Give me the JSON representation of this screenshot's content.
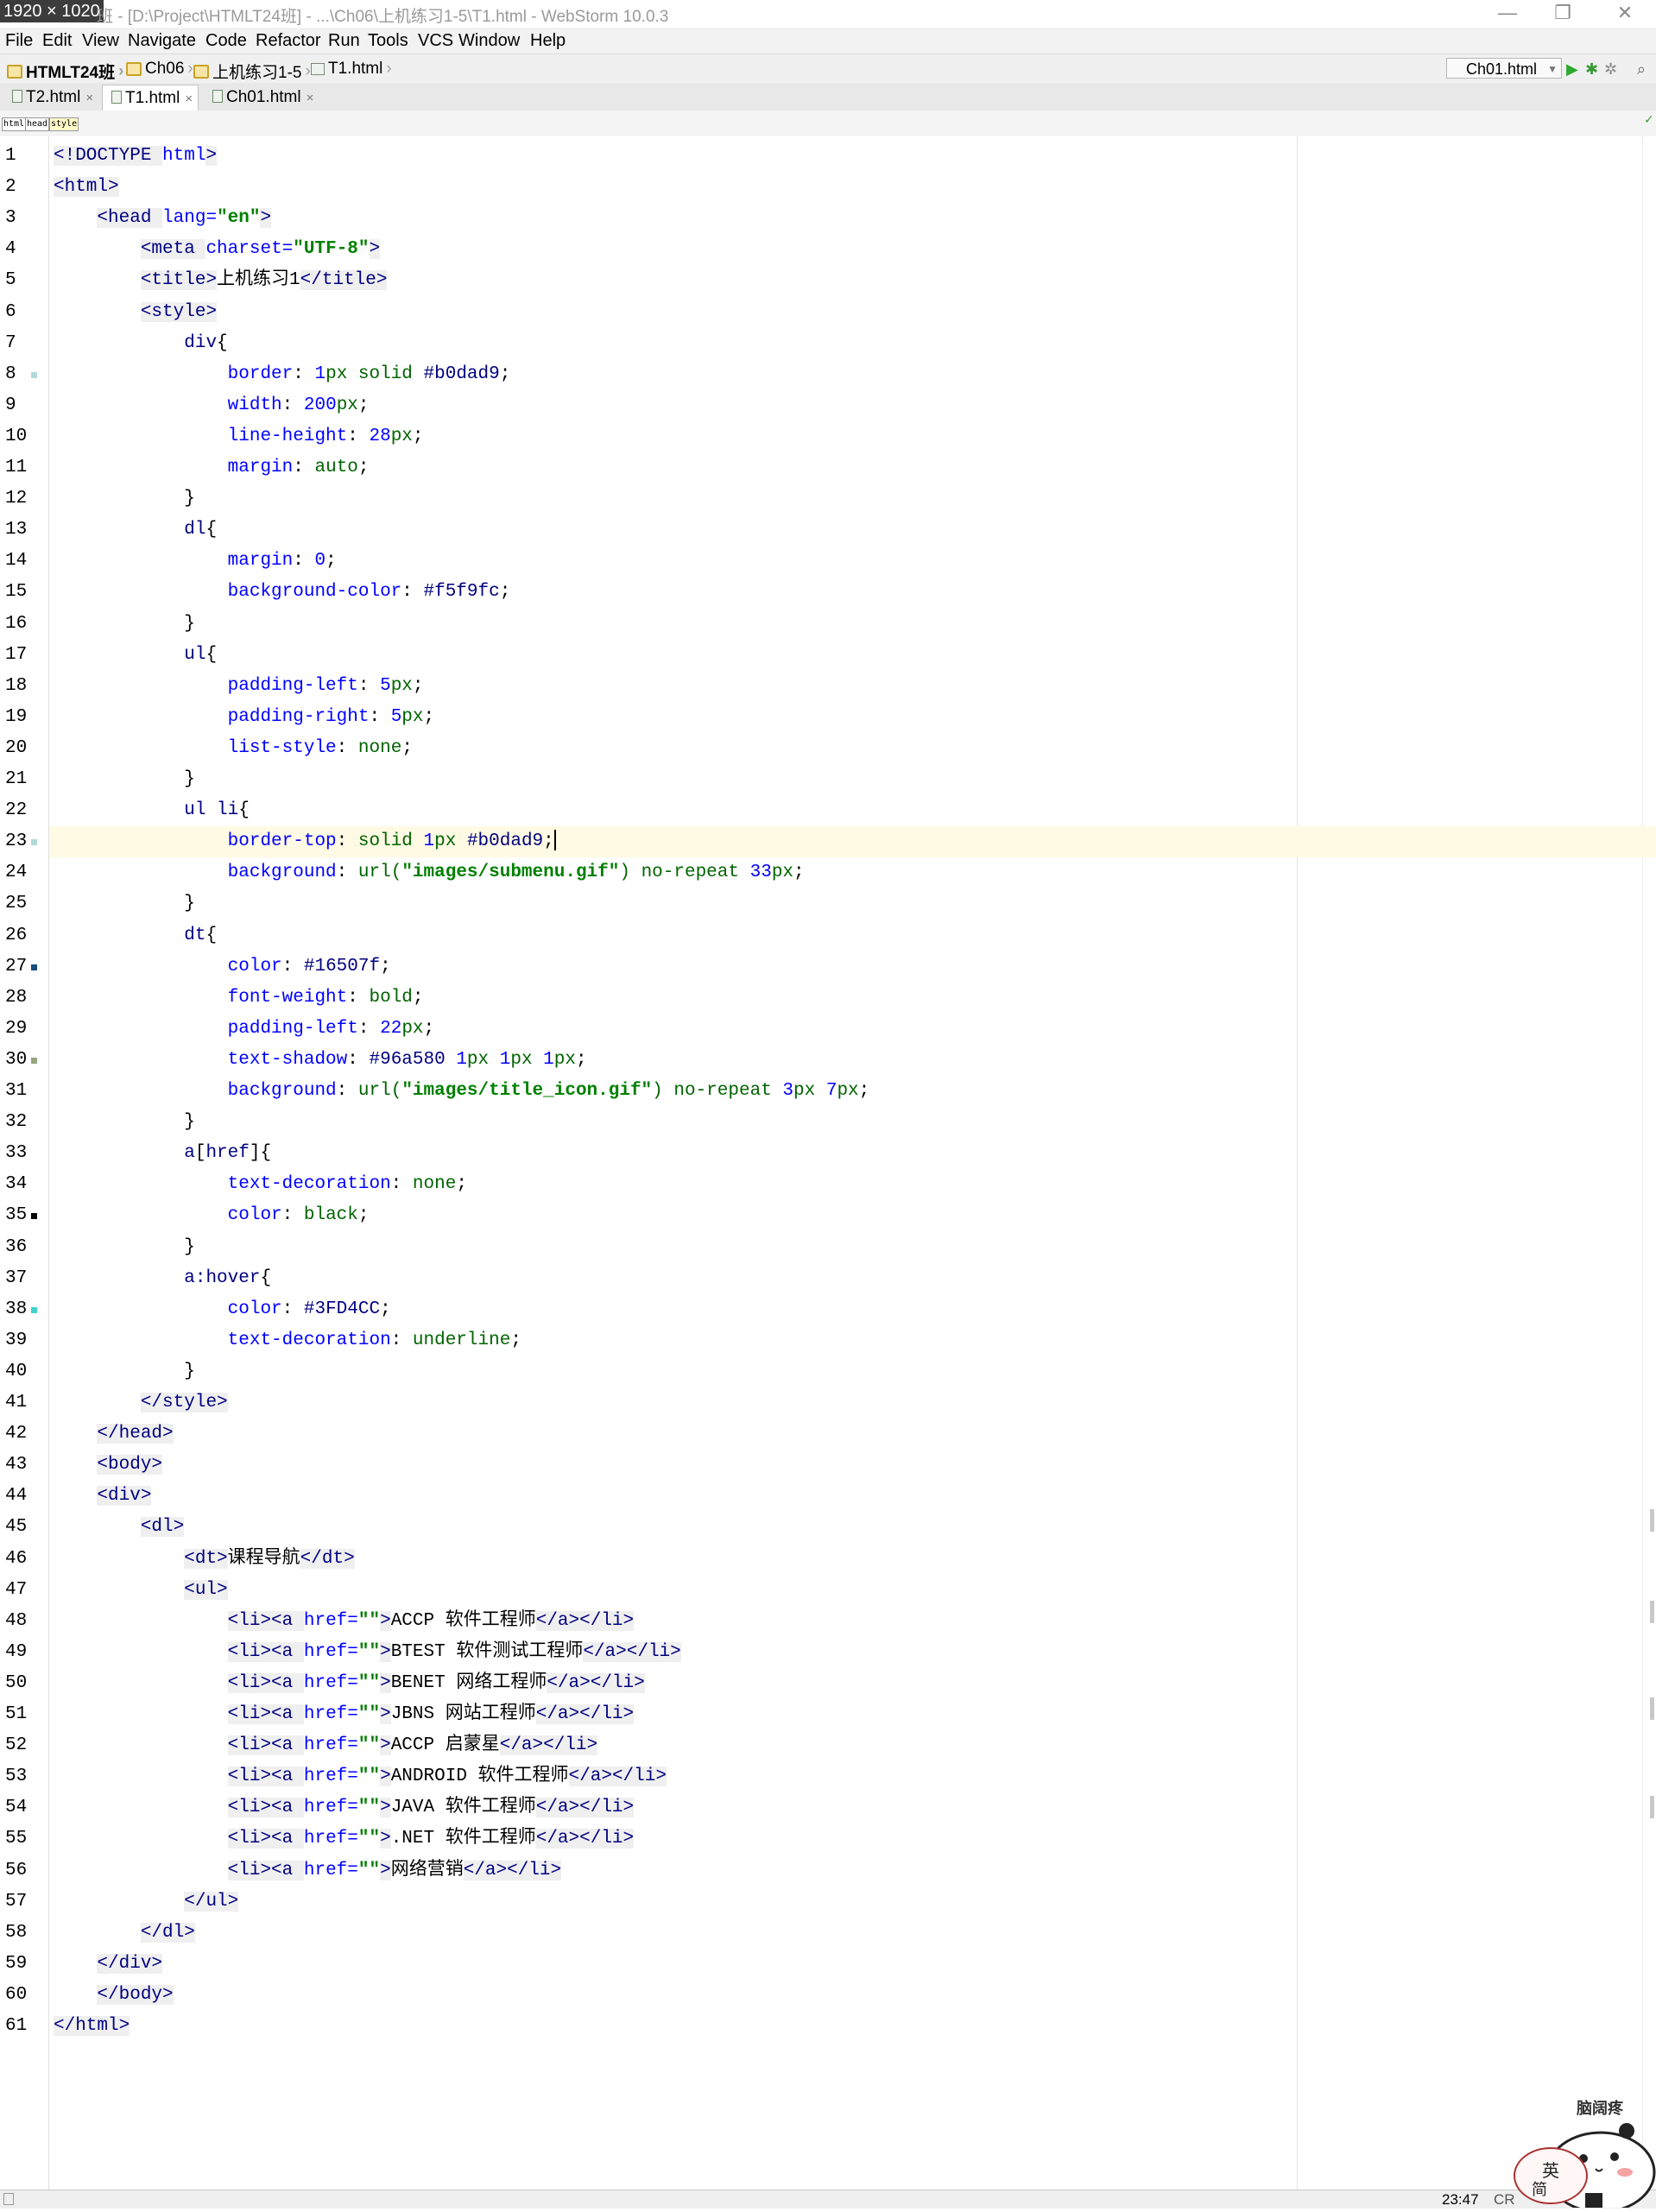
{
  "window": {
    "dim_badge": "1920 × 1020",
    "title": "班 - [D:\\Project\\HTMLT24班] - ...\\Ch06\\上机练习1-5\\T1.html - WebStorm 10.0.3",
    "minimize": "—",
    "restore": "❐",
    "close": "✕"
  },
  "menu": {
    "items": [
      {
        "label": "File"
      },
      {
        "label": "Edit"
      },
      {
        "label": "View"
      },
      {
        "label": "Navigate"
      },
      {
        "label": "Code"
      },
      {
        "label": "Refactor"
      },
      {
        "label": "Run"
      },
      {
        "label": "Tools"
      },
      {
        "label": "VCS"
      },
      {
        "label": "Window"
      },
      {
        "label": "Help"
      }
    ]
  },
  "breadcrumb": {
    "items": [
      {
        "label": "HTMLT24班",
        "icon": "folder-icon"
      },
      {
        "label": "Ch06",
        "icon": "folder-icon"
      },
      {
        "label": "上机练习1-5",
        "icon": "folder-icon"
      },
      {
        "label": "T1.html",
        "icon": "html-file-icon"
      }
    ],
    "run_config": "Ch01.html"
  },
  "tabs": [
    {
      "label": "T2.html",
      "active": false
    },
    {
      "label": "T1.html",
      "active": true
    },
    {
      "label": "Ch01.html",
      "active": false
    }
  ],
  "tag_path": [
    "html",
    "head",
    "style"
  ],
  "status": {
    "position": "23:47",
    "encoding": "CR"
  },
  "mascot": {
    "caption": "脑阔疼",
    "lang1": "英",
    "lang2": "简"
  },
  "editor": {
    "caret_line": 23,
    "colors": {
      "tag": "#000080",
      "attr": "#0000ff",
      "string": "#008000",
      "caret_row_bg": "#fffae3"
    },
    "lines": [
      [
        [
          "tg",
          "<!DOCTYPE "
        ],
        [
          "at",
          "html"
        ],
        [
          "tg",
          ">"
        ]
      ],
      [
        [
          "tg",
          "<html>"
        ]
      ],
      [
        [
          "i",
          "    "
        ],
        [
          "tg",
          "<head "
        ],
        [
          "at",
          "lang="
        ],
        [
          "sv",
          "\"en\""
        ],
        [
          "tg",
          ">"
        ]
      ],
      [
        [
          "i",
          "        "
        ],
        [
          "tg",
          "<meta "
        ],
        [
          "at",
          "charset="
        ],
        [
          "sv",
          "\"UTF-8\""
        ],
        [
          "tg",
          ">"
        ]
      ],
      [
        [
          "i",
          "        "
        ],
        [
          "tg",
          "<title>"
        ],
        [
          "pu",
          "上机练习1"
        ],
        [
          "tg",
          "</title>"
        ]
      ],
      [
        [
          "i",
          "        "
        ],
        [
          "tg",
          "<style>"
        ]
      ],
      [
        [
          "i",
          "            "
        ],
        [
          "sl",
          "div"
        ],
        [
          "pu",
          "{"
        ]
      ],
      [
        [
          "i",
          "                "
        ],
        [
          "pr",
          "border"
        ],
        [
          "pu",
          ": "
        ],
        [
          "nm",
          "1"
        ],
        [
          "vl",
          "px solid "
        ],
        [
          "sl",
          "#b0dad9"
        ],
        [
          "pu",
          ";"
        ]
      ],
      [
        [
          "i",
          "                "
        ],
        [
          "pr",
          "width"
        ],
        [
          "pu",
          ": "
        ],
        [
          "nm",
          "200"
        ],
        [
          "vl",
          "px"
        ],
        [
          "pu",
          ";"
        ]
      ],
      [
        [
          "i",
          "                "
        ],
        [
          "pr",
          "line-height"
        ],
        [
          "pu",
          ": "
        ],
        [
          "nm",
          "28"
        ],
        [
          "vl",
          "px"
        ],
        [
          "pu",
          ";"
        ]
      ],
      [
        [
          "i",
          "                "
        ],
        [
          "pr",
          "margin"
        ],
        [
          "pu",
          ": "
        ],
        [
          "vl",
          "auto"
        ],
        [
          "pu",
          ";"
        ]
      ],
      [
        [
          "i",
          "            "
        ],
        [
          "pu",
          "}"
        ]
      ],
      [
        [
          "i",
          "            "
        ],
        [
          "sl",
          "dl"
        ],
        [
          "pu",
          "{"
        ]
      ],
      [
        [
          "i",
          "                "
        ],
        [
          "pr",
          "margin"
        ],
        [
          "pu",
          ": "
        ],
        [
          "nm",
          "0"
        ],
        [
          "pu",
          ";"
        ]
      ],
      [
        [
          "i",
          "                "
        ],
        [
          "pr",
          "background-color"
        ],
        [
          "pu",
          ": "
        ],
        [
          "sl",
          "#f5f9fc"
        ],
        [
          "pu",
          ";"
        ]
      ],
      [
        [
          "i",
          "            "
        ],
        [
          "pu",
          "}"
        ]
      ],
      [
        [
          "i",
          "            "
        ],
        [
          "sl",
          "ul"
        ],
        [
          "pu",
          "{"
        ]
      ],
      [
        [
          "i",
          "                "
        ],
        [
          "pr",
          "padding-left"
        ],
        [
          "pu",
          ": "
        ],
        [
          "nm",
          "5"
        ],
        [
          "vl",
          "px"
        ],
        [
          "pu",
          ";"
        ]
      ],
      [
        [
          "i",
          "                "
        ],
        [
          "pr",
          "padding-right"
        ],
        [
          "pu",
          ": "
        ],
        [
          "nm",
          "5"
        ],
        [
          "vl",
          "px"
        ],
        [
          "pu",
          ";"
        ]
      ],
      [
        [
          "i",
          "                "
        ],
        [
          "pr",
          "list-style"
        ],
        [
          "pu",
          ": "
        ],
        [
          "vl",
          "none"
        ],
        [
          "pu",
          ";"
        ]
      ],
      [
        [
          "i",
          "            "
        ],
        [
          "pu",
          "}"
        ]
      ],
      [
        [
          "i",
          "            "
        ],
        [
          "sl",
          "ul li"
        ],
        [
          "pu",
          "{"
        ]
      ],
      [
        [
          "i",
          "                "
        ],
        [
          "pr",
          "border-top"
        ],
        [
          "pu",
          ": "
        ],
        [
          "vl",
          "solid "
        ],
        [
          "nm",
          "1"
        ],
        [
          "vl",
          "px "
        ],
        [
          "sl",
          "#b0dad9"
        ],
        [
          "pu",
          ";"
        ]
      ],
      [
        [
          "i",
          "                "
        ],
        [
          "pr",
          "background"
        ],
        [
          "pu",
          ": "
        ],
        [
          "vl",
          "url("
        ],
        [
          "sv",
          "\"images/submenu.gif\""
        ],
        [
          "vl",
          ") no-repeat "
        ],
        [
          "nm",
          "33"
        ],
        [
          "vl",
          "px"
        ],
        [
          "pu",
          ";"
        ]
      ],
      [
        [
          "i",
          "            "
        ],
        [
          "pu",
          "}"
        ]
      ],
      [
        [
          "i",
          "            "
        ],
        [
          "sl",
          "dt"
        ],
        [
          "pu",
          "{"
        ]
      ],
      [
        [
          "i",
          "                "
        ],
        [
          "pr",
          "color"
        ],
        [
          "pu",
          ": "
        ],
        [
          "sl",
          "#16507f"
        ],
        [
          "pu",
          ";"
        ]
      ],
      [
        [
          "i",
          "                "
        ],
        [
          "pr",
          "font-weight"
        ],
        [
          "pu",
          ": "
        ],
        [
          "vl",
          "bold"
        ],
        [
          "pu",
          ";"
        ]
      ],
      [
        [
          "i",
          "                "
        ],
        [
          "pr",
          "padding-left"
        ],
        [
          "pu",
          ": "
        ],
        [
          "nm",
          "22"
        ],
        [
          "vl",
          "px"
        ],
        [
          "pu",
          ";"
        ]
      ],
      [
        [
          "i",
          "                "
        ],
        [
          "pr",
          "text-shadow"
        ],
        [
          "pu",
          ": "
        ],
        [
          "sl",
          "#96a580 "
        ],
        [
          "nm",
          "1"
        ],
        [
          "vl",
          "px "
        ],
        [
          "nm",
          "1"
        ],
        [
          "vl",
          "px "
        ],
        [
          "nm",
          "1"
        ],
        [
          "vl",
          "px"
        ],
        [
          "pu",
          ";"
        ]
      ],
      [
        [
          "i",
          "                "
        ],
        [
          "pr",
          "background"
        ],
        [
          "pu",
          ": "
        ],
        [
          "vl",
          "url("
        ],
        [
          "sv",
          "\"images/title_icon.gif\""
        ],
        [
          "vl",
          ") no-repeat "
        ],
        [
          "nm",
          "3"
        ],
        [
          "vl",
          "px "
        ],
        [
          "nm",
          "7"
        ],
        [
          "vl",
          "px"
        ],
        [
          "pu",
          ";"
        ]
      ],
      [
        [
          "i",
          "            "
        ],
        [
          "pu",
          "}"
        ]
      ],
      [
        [
          "i",
          "            "
        ],
        [
          "sl",
          "a"
        ],
        [
          "pu",
          "["
        ],
        [
          "sl",
          "href"
        ],
        [
          "pu",
          "]{"
        ]
      ],
      [
        [
          "i",
          "                "
        ],
        [
          "pr",
          "text-decoration"
        ],
        [
          "pu",
          ": "
        ],
        [
          "vl",
          "none"
        ],
        [
          "pu",
          ";"
        ]
      ],
      [
        [
          "i",
          "                "
        ],
        [
          "pr",
          "color"
        ],
        [
          "pu",
          ": "
        ],
        [
          "vl",
          "black"
        ],
        [
          "pu",
          ";"
        ]
      ],
      [
        [
          "i",
          "            "
        ],
        [
          "pu",
          "}"
        ]
      ],
      [
        [
          "i",
          "            "
        ],
        [
          "sl",
          "a:hover"
        ],
        [
          "pu",
          "{"
        ]
      ],
      [
        [
          "i",
          "                "
        ],
        [
          "pr",
          "color"
        ],
        [
          "pu",
          ": "
        ],
        [
          "sl",
          "#3FD4CC"
        ],
        [
          "pu",
          ";"
        ]
      ],
      [
        [
          "i",
          "                "
        ],
        [
          "pr",
          "text-decoration"
        ],
        [
          "pu",
          ": "
        ],
        [
          "vl",
          "underline"
        ],
        [
          "pu",
          ";"
        ]
      ],
      [
        [
          "i",
          "            "
        ],
        [
          "pu",
          "}"
        ]
      ],
      [
        [
          "i",
          "        "
        ],
        [
          "tg",
          "</style>"
        ]
      ],
      [
        [
          "i",
          "    "
        ],
        [
          "tg",
          "</head>"
        ]
      ],
      [
        [
          "i",
          "    "
        ],
        [
          "tg",
          "<body>"
        ]
      ],
      [
        [
          "i",
          "    "
        ],
        [
          "tg",
          "<div>"
        ]
      ],
      [
        [
          "i",
          "        "
        ],
        [
          "tg",
          "<dl>"
        ]
      ],
      [
        [
          "i",
          "            "
        ],
        [
          "tg",
          "<dt>"
        ],
        [
          "pu",
          "课程导航"
        ],
        [
          "tg",
          "</dt>"
        ]
      ],
      [
        [
          "i",
          "            "
        ],
        [
          "tg",
          "<ul>"
        ]
      ],
      [
        [
          "i",
          "                "
        ],
        [
          "tg",
          "<li><a "
        ],
        [
          "at",
          "href="
        ],
        [
          "sv",
          "\"\""
        ],
        [
          "tg",
          ">"
        ],
        [
          "pu",
          "ACCP 软件工程师"
        ],
        [
          "tg",
          "</a></li>"
        ]
      ],
      [
        [
          "i",
          "                "
        ],
        [
          "tg",
          "<li><a "
        ],
        [
          "at",
          "href="
        ],
        [
          "sv",
          "\"\""
        ],
        [
          "tg",
          ">"
        ],
        [
          "pu",
          "BTEST 软件测试工程师"
        ],
        [
          "tg",
          "</a></li>"
        ]
      ],
      [
        [
          "i",
          "                "
        ],
        [
          "tg",
          "<li><a "
        ],
        [
          "at",
          "href="
        ],
        [
          "sv",
          "\"\""
        ],
        [
          "tg",
          ">"
        ],
        [
          "pu",
          "BENET 网络工程师"
        ],
        [
          "tg",
          "</a></li>"
        ]
      ],
      [
        [
          "i",
          "                "
        ],
        [
          "tg",
          "<li><a "
        ],
        [
          "at",
          "href="
        ],
        [
          "sv",
          "\"\""
        ],
        [
          "tg",
          ">"
        ],
        [
          "pu",
          "JBNS 网站工程师"
        ],
        [
          "tg",
          "</a></li>"
        ]
      ],
      [
        [
          "i",
          "                "
        ],
        [
          "tg",
          "<li><a "
        ],
        [
          "at",
          "href="
        ],
        [
          "sv",
          "\"\""
        ],
        [
          "tg",
          ">"
        ],
        [
          "pu",
          "ACCP 启蒙星"
        ],
        [
          "tg",
          "</a></li>"
        ]
      ],
      [
        [
          "i",
          "                "
        ],
        [
          "tg",
          "<li><a "
        ],
        [
          "at",
          "href="
        ],
        [
          "sv",
          "\"\""
        ],
        [
          "tg",
          ">"
        ],
        [
          "pu",
          "ANDROID 软件工程师"
        ],
        [
          "tg",
          "</a></li>"
        ]
      ],
      [
        [
          "i",
          "                "
        ],
        [
          "tg",
          "<li><a "
        ],
        [
          "at",
          "href="
        ],
        [
          "sv",
          "\"\""
        ],
        [
          "tg",
          ">"
        ],
        [
          "pu",
          "JAVA 软件工程师"
        ],
        [
          "tg",
          "</a></li>"
        ]
      ],
      [
        [
          "i",
          "                "
        ],
        [
          "tg",
          "<li><a "
        ],
        [
          "at",
          "href="
        ],
        [
          "sv",
          "\"\""
        ],
        [
          "tg",
          ">"
        ],
        [
          "pu",
          ".NET 软件工程师"
        ],
        [
          "tg",
          "</a></li>"
        ]
      ],
      [
        [
          "i",
          "                "
        ],
        [
          "tg",
          "<li><a "
        ],
        [
          "at",
          "href="
        ],
        [
          "sv",
          "\"\""
        ],
        [
          "tg",
          ">"
        ],
        [
          "pu",
          "网络营销"
        ],
        [
          "tg",
          "</a></li>"
        ]
      ],
      [
        [
          "i",
          "            "
        ],
        [
          "tg",
          "</ul>"
        ]
      ],
      [
        [
          "i",
          "        "
        ],
        [
          "tg",
          "</dl>"
        ]
      ],
      [
        [
          "i",
          "    "
        ],
        [
          "tg",
          "</div>"
        ]
      ],
      [
        [
          "i",
          "    "
        ],
        [
          "tg",
          "</body>"
        ]
      ],
      [
        [
          "tg",
          "</html>"
        ]
      ]
    ],
    "markers": [
      {
        "line": 8,
        "color": "#b0dad9"
      },
      {
        "line": 23,
        "color": "#b0dad9"
      },
      {
        "line": 27,
        "color": "#16507f"
      },
      {
        "line": 30,
        "color": "#96a580"
      },
      {
        "line": 35,
        "color": "#000000"
      },
      {
        "line": 38,
        "color": "#3FD4CC"
      }
    ]
  }
}
